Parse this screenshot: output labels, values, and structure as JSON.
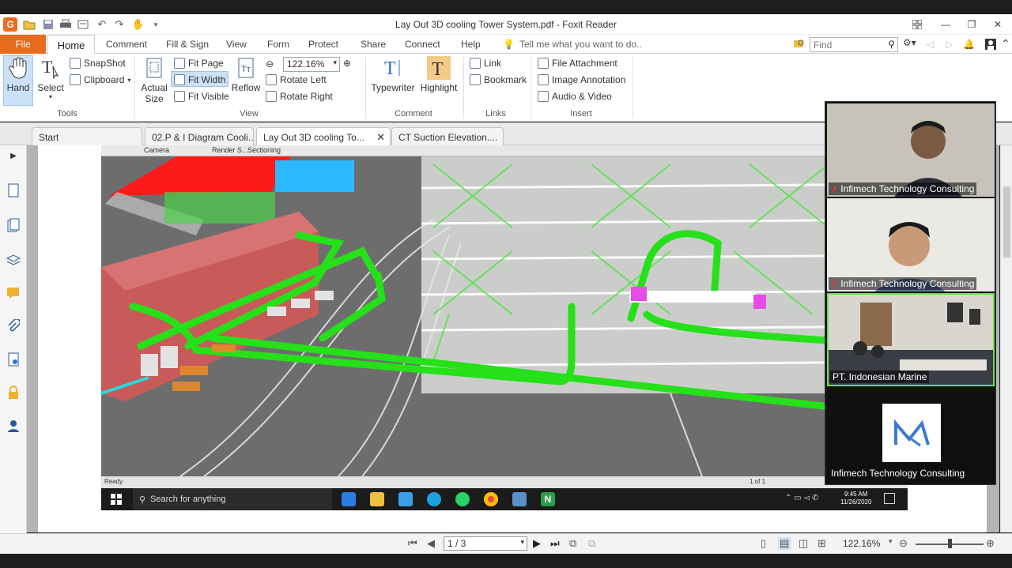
{
  "window": {
    "title": "Lay Out 3D cooling Tower System.pdf - Foxit Reader"
  },
  "menu": {
    "file": "File",
    "items": [
      "Home",
      "Comment",
      "Fill & Sign",
      "View",
      "Form",
      "Protect",
      "Share",
      "Connect",
      "Help"
    ],
    "tell_me": "Tell me what you want to do..",
    "find_placeholder": "Find"
  },
  "ribbon": {
    "tools": {
      "hand": "Hand",
      "select": "Select",
      "snapshot": "SnapShot",
      "clipboard": "Clipboard",
      "group": "Tools"
    },
    "view": {
      "actual_size_1": "Actual",
      "actual_size_2": "Size",
      "fit_page": "Fit Page",
      "fit_width": "Fit Width",
      "fit_visible": "Fit Visible",
      "reflow": "Reflow",
      "zoom": "122.16%",
      "rotate_left": "Rotate Left",
      "rotate_right": "Rotate Right",
      "group": "View"
    },
    "comment": {
      "typewriter": "Typewriter",
      "highlight": "Highlight",
      "group": "Comment"
    },
    "links": {
      "link": "Link",
      "bookmark": "Bookmark",
      "group": "Links"
    },
    "insert": {
      "file_attachment": "File Attachment",
      "image_annotation": "Image Annotation",
      "audio_video": "Audio & Video",
      "group": "Insert"
    }
  },
  "tabs": [
    "Start",
    "02.P & I Diagram Cooli...",
    "Lay Out 3D cooling To...",
    "CT Suction Elevation...."
  ],
  "embedded": {
    "toolbar": [
      "Camera",
      "Render S...",
      "Sectioning"
    ],
    "status": "Ready",
    "page_counter": "1 of 1",
    "taskbar_search": "Search for anything",
    "clock_time": "9:45 AM",
    "clock_date": "11/26/2020"
  },
  "bottom": {
    "page": "1 / 3",
    "zoom": "122.16%"
  },
  "participants": [
    {
      "name": "Infimech Technology Consulting",
      "muted": true
    },
    {
      "name": "Infimech Technology Consulting",
      "muted": true
    },
    {
      "name": "PT. Indonesian Marine",
      "muted": false
    },
    {
      "name": "Infimech Technology Consulting",
      "muted": false
    }
  ],
  "colors": {
    "file_tab": "#e86b1e",
    "pipe": "#26e01a",
    "roof": "#ff1a1a",
    "tank": "#c85a5a",
    "selection": "#cce1f6"
  }
}
